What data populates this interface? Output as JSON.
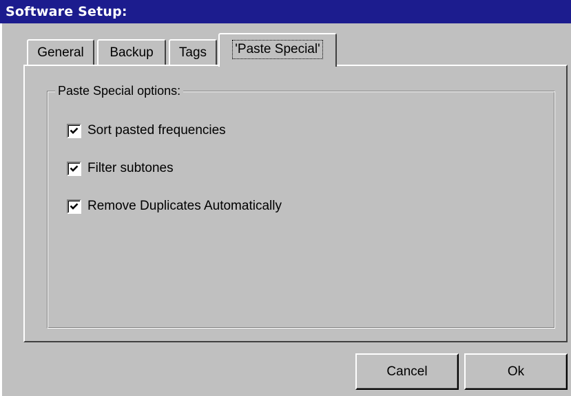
{
  "window": {
    "title": "Software Setup:"
  },
  "tabs": [
    {
      "label": "General",
      "active": false
    },
    {
      "label": "Backup",
      "active": false
    },
    {
      "label": "Tags",
      "active": false
    },
    {
      "label": "'Paste Special'",
      "active": true
    }
  ],
  "group": {
    "label": "Paste Special options:",
    "options": [
      {
        "label": "Sort pasted frequencies",
        "checked": true
      },
      {
        "label": "Filter subtones",
        "checked": true
      },
      {
        "label": "Remove Duplicates Automatically",
        "checked": true
      }
    ]
  },
  "buttons": {
    "cancel": "Cancel",
    "ok": "Ok"
  },
  "colors": {
    "titlebar": "#1c1c8e",
    "face": "#c0c0c0"
  },
  "icons": {
    "check": "checkmark-icon"
  }
}
